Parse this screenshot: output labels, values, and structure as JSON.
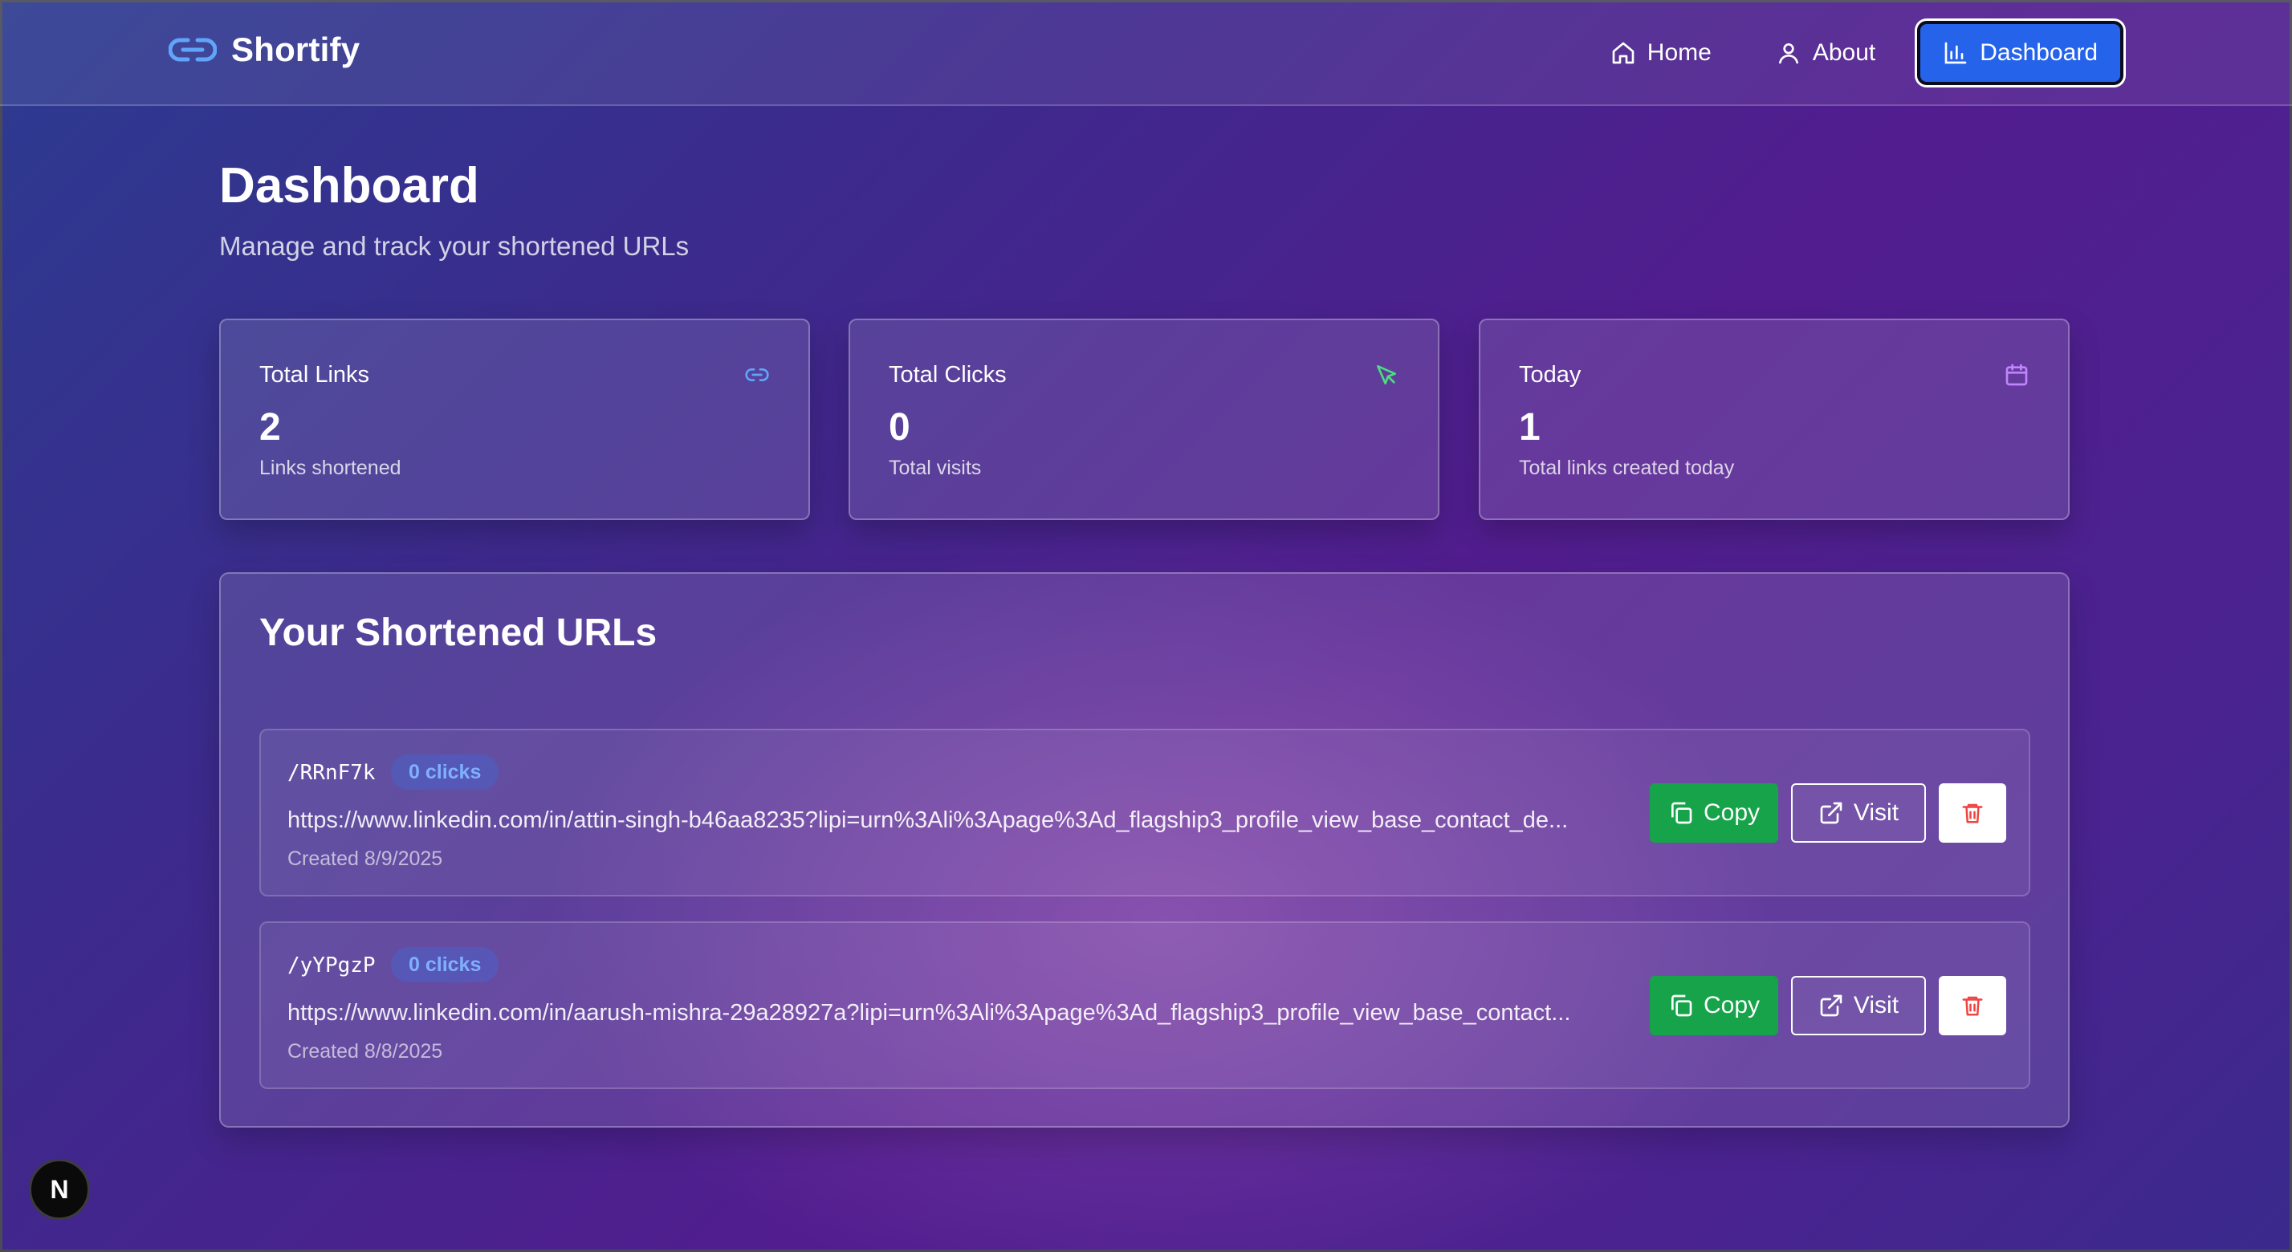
{
  "app": {
    "name": "Shortify",
    "accent": "#2563eb"
  },
  "nav": {
    "items": [
      {
        "label": "Home",
        "icon": "home-icon"
      },
      {
        "label": "About",
        "icon": "user-icon"
      },
      {
        "label": "Dashboard",
        "icon": "bar-chart-icon",
        "active": true
      }
    ]
  },
  "header": {
    "title": "Dashboard",
    "subtitle": "Manage and track your shortened URLs"
  },
  "stats": [
    {
      "label": "Total Links",
      "value": "2",
      "note": "Links shortened",
      "icon": "link-icon",
      "icon_color": "#60a5fa"
    },
    {
      "label": "Total Clicks",
      "value": "0",
      "note": "Total visits",
      "icon": "cursor-icon",
      "icon_color": "#4ade80"
    },
    {
      "label": "Today",
      "value": "1",
      "note": "Total links created today",
      "icon": "calendar-icon",
      "icon_color": "#c084fc"
    }
  ],
  "urls": {
    "title": "Your Shortened URLs",
    "items": [
      {
        "slug": "/RRnF7k",
        "clicks": "0 clicks",
        "url": "https://www.linkedin.com/in/attin-singh-b46aa8235?lipi=urn%3Ali%3Apage%3Ad_flagship3_profile_view_base_contact_de...",
        "created": "Created 8/9/2025"
      },
      {
        "slug": "/yYPgzP",
        "clicks": "0 clicks",
        "url": "https://www.linkedin.com/in/aarush-mishra-29a28927a?lipi=urn%3Ali%3Apage%3Ad_flagship3_profile_view_base_contact...",
        "created": "Created 8/8/2025"
      }
    ],
    "actions": {
      "copy": "Copy",
      "visit": "Visit"
    }
  },
  "corner_badge": {
    "letter": "N"
  },
  "colors": {
    "copy_button": "#16a34a",
    "delete_icon": "#ef4444",
    "badge_text": "#7fb0ff"
  }
}
